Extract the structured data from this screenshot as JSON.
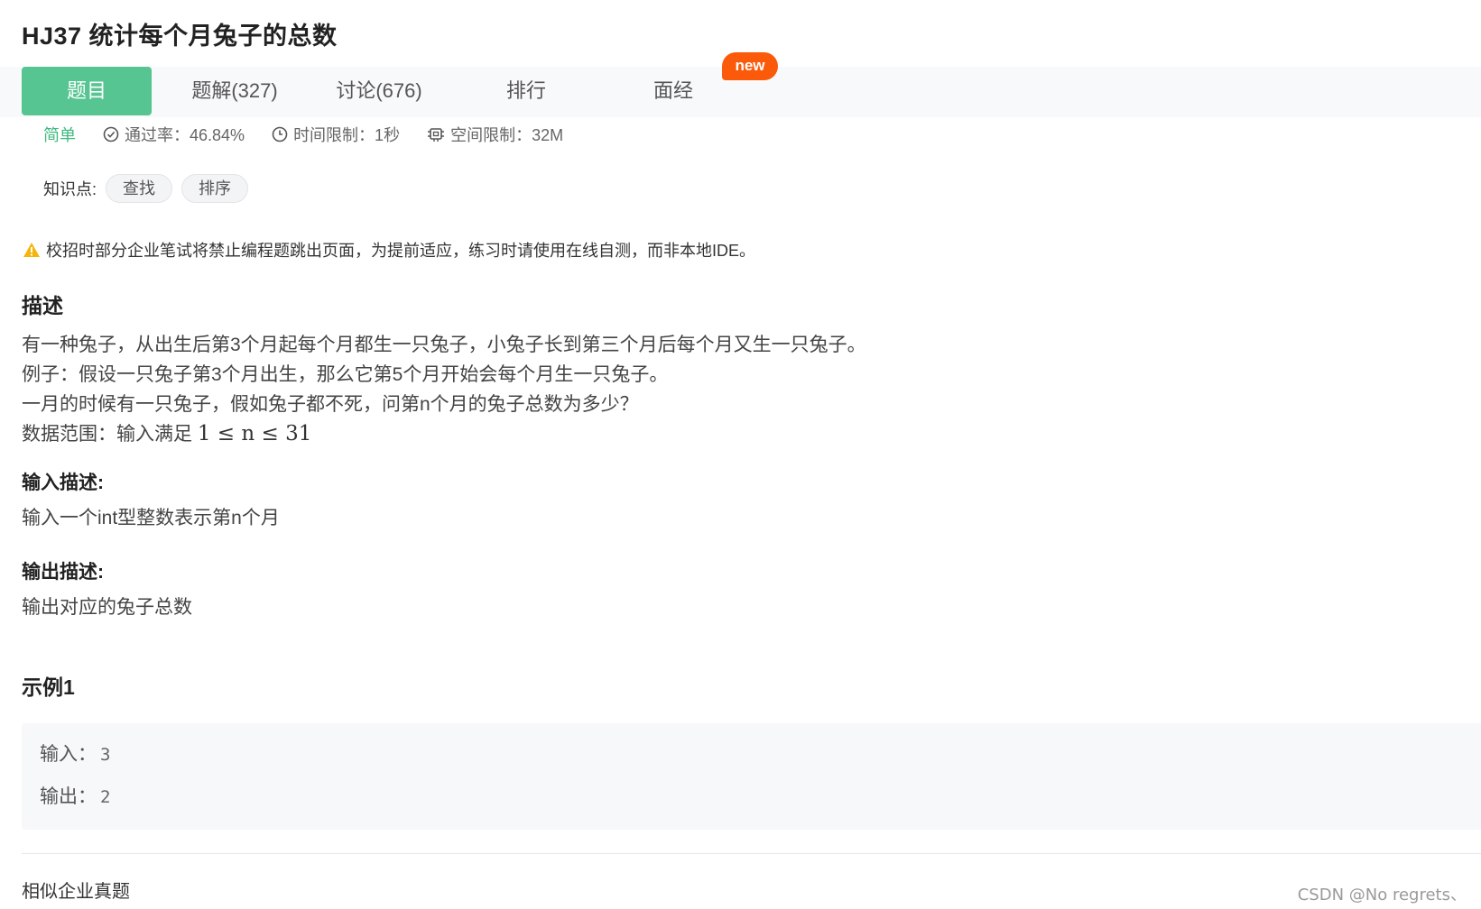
{
  "problem": {
    "title": "HJ37  统计每个月兔子的总数"
  },
  "tabs": [
    {
      "label": "题目",
      "active": true
    },
    {
      "label": "题解(327)",
      "active": false
    },
    {
      "label": "讨论(676)",
      "active": false
    },
    {
      "label": "排行",
      "active": false
    },
    {
      "label": "面经",
      "active": false
    }
  ],
  "new_badge": "new",
  "meta": {
    "difficulty": "简单",
    "pass_rate": "通过率：46.84%",
    "time_limit": "时间限制：1秒",
    "memory_limit": "空间限制：32M"
  },
  "knowledge": {
    "label": "知识点:",
    "tags": [
      "查找",
      "排序"
    ]
  },
  "warning": "校招时部分企业笔试将禁止编程题跳出页面，为提前适应，练习时请使用在线自测，而非本地IDE。",
  "description": {
    "heading": "描述",
    "lines": [
      "有一种兔子，从出生后第3个月起每个月都生一只兔子，小兔子长到第三个月后每个月又生一只兔子。",
      "例子：假设一只兔子第3个月出生，那么它第5个月开始会每个月生一只兔子。",
      "一月的时候有一只兔子，假如兔子都不死，问第n个月的兔子总数为多少？"
    ],
    "range_prefix": "数据范围：输入满足 ",
    "range_math": "1 ≤ n ≤ 31"
  },
  "input_desc": {
    "heading": "输入描述:",
    "text": "输入一个int型整数表示第n个月"
  },
  "output_desc": {
    "heading": "输出描述:",
    "text": "输出对应的兔子总数"
  },
  "example": {
    "heading": "示例1",
    "input_label": "输入：",
    "input_value": "3",
    "output_label": "输出：",
    "output_value": "2"
  },
  "similar": "相似企业真题",
  "watermark": "CSDN @No regrets、",
  "colors": {
    "accent": "#56c592",
    "badge": "#fa5a0a",
    "warning": "#f5b50a"
  }
}
